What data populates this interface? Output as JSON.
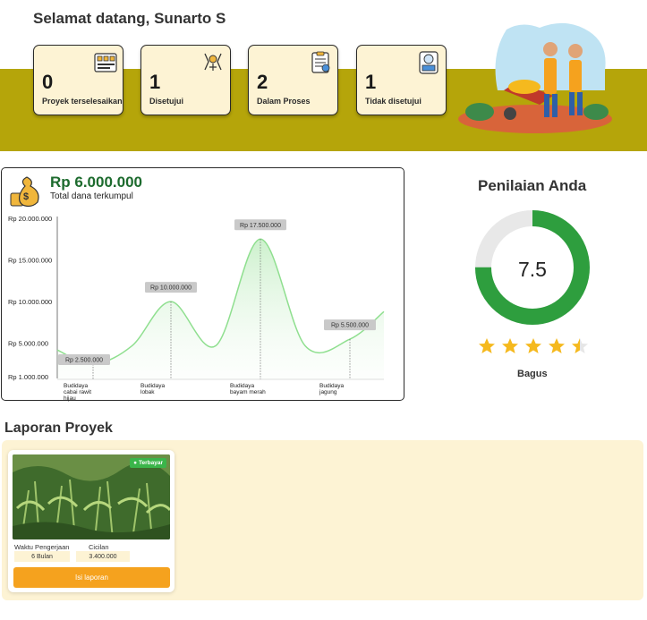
{
  "header": {
    "welcome": "Selamat datang, Sunarto S"
  },
  "stats": [
    {
      "value": "0",
      "label": "Proyek terselesaikan",
      "icon": "completed-projects-icon"
    },
    {
      "value": "1",
      "label": "Disetujui",
      "icon": "approved-icon"
    },
    {
      "value": "2",
      "label": "Dalam Proses",
      "icon": "in-process-icon"
    },
    {
      "value": "1",
      "label": "Tidak disetujui",
      "icon": "rejected-icon"
    }
  ],
  "fund": {
    "amount": "Rp 6.000.000",
    "subtitle": "Total dana terkumpul"
  },
  "chart_data": {
    "type": "area",
    "categories": [
      "Budidaya cabai rawit hijau",
      "Budidaya lobak",
      "Budidaya bayam merah",
      "Budidaya jagung"
    ],
    "values": [
      2500000,
      10000000,
      17500000,
      5500000
    ],
    "value_labels": [
      "Rp 2.500.000",
      "Rp 10.000.000",
      "Rp 17.500.000",
      "Rp 5.500.000"
    ],
    "y_ticks": [
      1000000,
      5000000,
      10000000,
      15000000,
      20000000
    ],
    "y_tick_labels": [
      "Rp 1.000.000",
      "Rp 5.000.000",
      "Rp 10.000.000",
      "Rp 15.000.000",
      "Rp 20.000.000"
    ],
    "ylim": [
      1000000,
      20000000
    ],
    "colors": {
      "line": "#8fdf8f",
      "fill": "#e6f7e6"
    }
  },
  "rating": {
    "title": "Penilaian Anda",
    "score": "7.5",
    "score_fraction": 0.75,
    "stars": 4.5,
    "word": "Bagus",
    "colors": {
      "fill": "#2e9e3e",
      "track": "#e8e8e8",
      "star": "#f5b91e"
    }
  },
  "reports": {
    "title": "Laporan Proyek",
    "items": [
      {
        "badge": "Terbayar",
        "duration_label": "Waktu Pengerjaan",
        "duration_value": "6 Bulan",
        "installment_label": "Cicilan",
        "installment_value": "3.400.000",
        "button_label": "Isi laporan"
      }
    ]
  }
}
